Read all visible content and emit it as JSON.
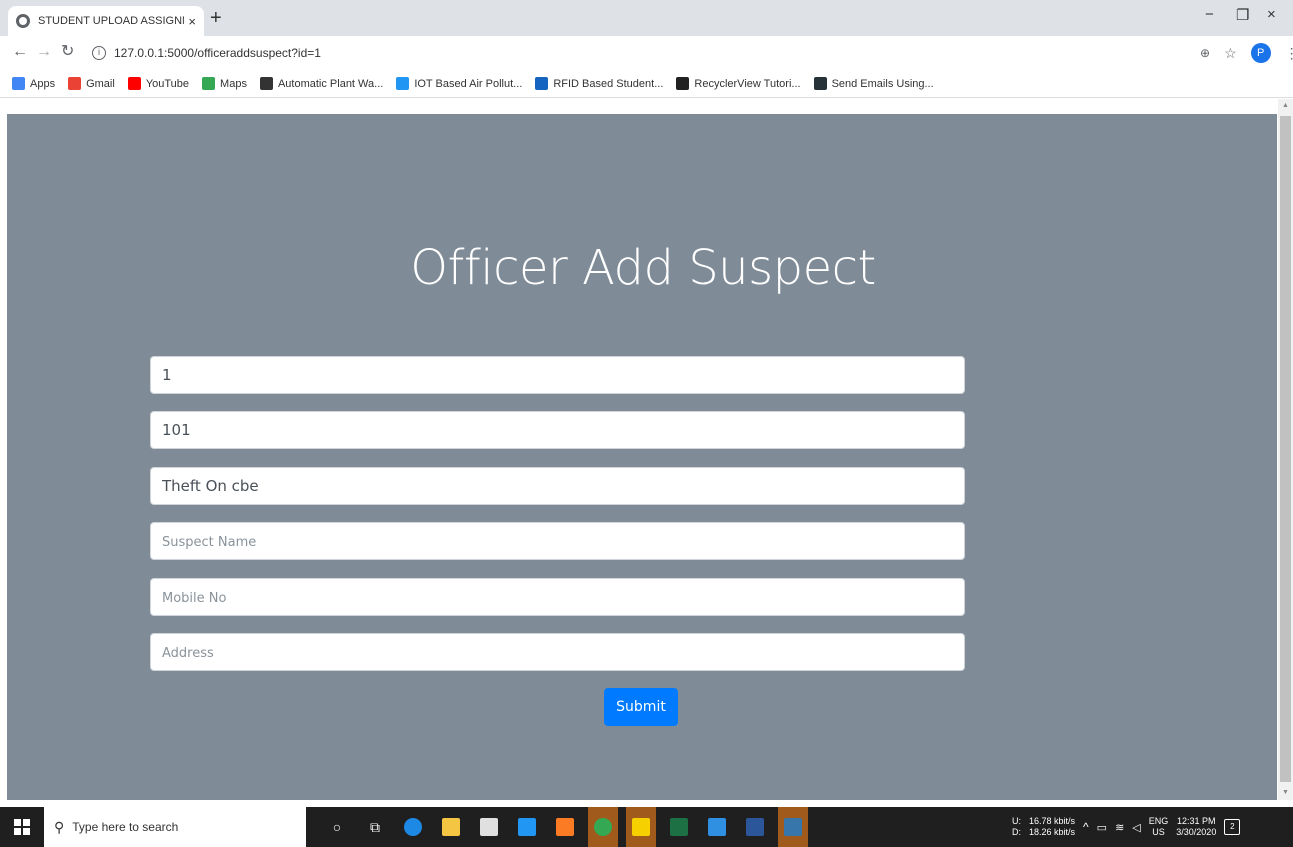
{
  "browser": {
    "tab_title": "STUDENT UPLOAD ASSIGNMENT",
    "tab_close": "×",
    "new_tab": "+",
    "window_minimize": "−",
    "window_restore": "❐",
    "window_close": "×",
    "url": "127.0.0.1:5000/officeraddsuspect?id=1",
    "profile_initial": "P",
    "bookmarks": [
      {
        "label": "Apps",
        "color": "#4285f4"
      },
      {
        "label": "Gmail",
        "color": "#ea4335"
      },
      {
        "label": "YouTube",
        "color": "#ff0000"
      },
      {
        "label": "Maps",
        "color": "#34a853"
      },
      {
        "label": "Automatic Plant Wa...",
        "color": "#333333"
      },
      {
        "label": "IOT Based Air Pollut...",
        "color": "#2196f3"
      },
      {
        "label": "RFID Based Student...",
        "color": "#1565c0"
      },
      {
        "label": "RecyclerView Tutori...",
        "color": "#222222"
      },
      {
        "label": "Send Emails Using...",
        "color": "#263238"
      }
    ]
  },
  "page": {
    "heading": "Officer Add Suspect",
    "fields": [
      {
        "value": "1",
        "placeholder": ""
      },
      {
        "value": "101",
        "placeholder": ""
      },
      {
        "value": "Theft On cbe",
        "placeholder": ""
      },
      {
        "value": "",
        "placeholder": "Suspect Name"
      },
      {
        "value": "",
        "placeholder": "Mobile No"
      },
      {
        "value": "",
        "placeholder": "Address"
      }
    ],
    "submit_label": "Submit",
    "background_color": "#7f8c98",
    "accent_color": "#007bff"
  },
  "taskbar": {
    "search_placeholder": "Type here to search",
    "upload_label": "U:",
    "download_label": "D:",
    "upload_speed": "16.78 kbit/s",
    "download_speed": "18.26 kbit/s",
    "language": "ENG",
    "region": "US",
    "time": "12:31 PM",
    "date": "3/30/2020",
    "notification_count": "2"
  }
}
